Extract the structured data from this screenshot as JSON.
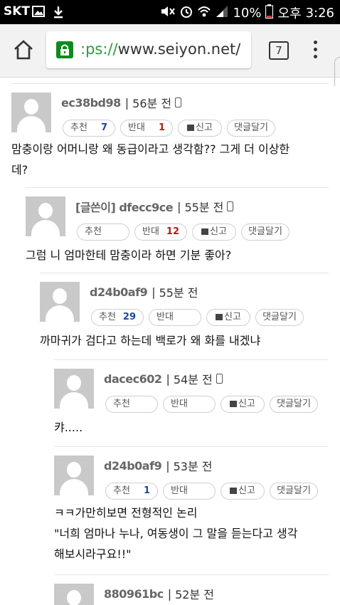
{
  "status_bar": {
    "carrier": "SKT",
    "battery": "10%",
    "ampm": "오후",
    "time": "3:26"
  },
  "browser": {
    "url_scheme": ":ps://",
    "url_rest": "www.seiyon.net/",
    "tab_count": "7"
  },
  "comments": [
    {
      "author": "ec38bd98",
      "time": "56분 전",
      "mobile": true,
      "up_label": "추천",
      "up_count": "7",
      "down_label": "반대",
      "down_count": "1",
      "report_label": "신고",
      "reply_label": "댓글달기",
      "lines": [
        "맘충이랑 어머니랑 왜 동급이라고 생각함?? 그게 더 이상한",
        "데?"
      ]
    },
    {
      "author": "[글쓴이] dfecc9ce",
      "time": "55분 전",
      "mobile": true,
      "up_label": "추천",
      "up_count": "",
      "down_label": "반대",
      "down_count": "12",
      "report_label": "신고",
      "reply_label": "댓글달기",
      "lines": [
        "그럼 니 엄마한테 맘충이라 하면 기분 좋아?"
      ]
    },
    {
      "author": "d24b0af9",
      "time": "55분 전",
      "mobile": false,
      "up_label": "추천",
      "up_count": "29",
      "down_label": "반대",
      "down_count": "",
      "report_label": "신고",
      "reply_label": "댓글달기",
      "lines": [
        "까마귀가 검다고 하는데 백로가 왜 화를 내겠냐"
      ]
    },
    {
      "author": "dacec602",
      "time": "54분 전",
      "mobile": true,
      "up_label": "추천",
      "up_count": "",
      "down_label": "반대",
      "down_count": "",
      "report_label": "신고",
      "reply_label": "댓글달기",
      "lines": [
        "캬....."
      ]
    },
    {
      "author": "d24b0af9",
      "time": "53분 전",
      "mobile": false,
      "up_label": "추천",
      "up_count": "1",
      "down_label": "반대",
      "down_count": "",
      "report_label": "신고",
      "reply_label": "댓글달기",
      "lines": [
        "ㅋㅋ가만히보면 전형적인 논리",
        "\"너희 엄마나 누나, 여동생이 그 말을 듣는다고 생각",
        "해보시라구요!!\""
      ]
    },
    {
      "author": "880961bc",
      "time": "52분 전",
      "mobile": false,
      "lines": []
    }
  ]
}
